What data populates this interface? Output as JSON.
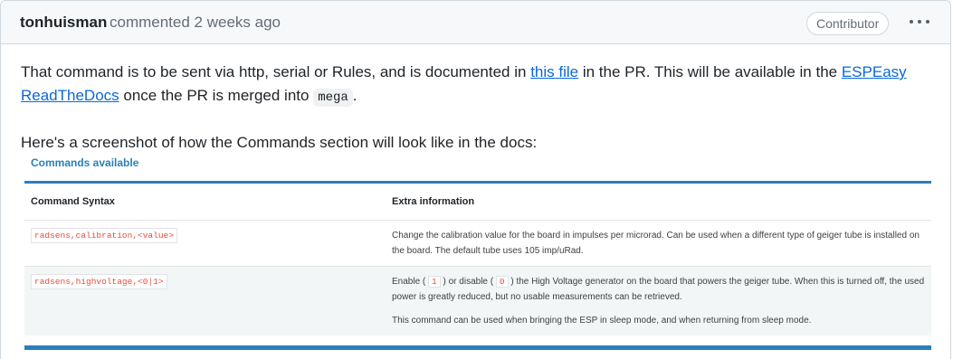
{
  "header": {
    "author": "tonhuisman",
    "action": "commented 2 weeks ago",
    "badge": "Contributor"
  },
  "body": {
    "p1_part1": "That command is to be sent via http, serial or Rules, and is documented in ",
    "p1_link1": "this file",
    "p1_part2": " in the PR. This will be available in the ",
    "p1_link2": "ESPEasy ReadTheDocs",
    "p1_part3": " once the PR is merged into ",
    "p1_code": "mega",
    "p1_part4": ".",
    "p2": "Here's a screenshot of how the Commands section will look like in the docs:"
  },
  "screenshot": {
    "title": "Commands available",
    "headers": [
      "Command Syntax",
      "Extra information"
    ],
    "row1": {
      "command": "radsens,calibration,<value>",
      "info": "Change the calibration value for the board in impulses per microrad. Can be used when a different type of geiger tube is installed on the board. The default tube uses 105 imp/uRad."
    },
    "row2": {
      "command": "radsens,highvoltage,<0|1>",
      "info_a": "Enable ( ",
      "code_on": "1",
      "info_b": " ) or disable ( ",
      "code_off": "0",
      "info_c": " ) the High Voltage generator on the board that powers the geiger tube. When this is turned off, the used power is greatly reduced, but no usable measurements can be retrieved.",
      "info2": "This command can be used when bringing the ESP in sleep mode, and when returning from sleep mode."
    }
  },
  "colors": {
    "link": "#0969da",
    "accent": "#2980b9",
    "code": "#e74c3c"
  }
}
